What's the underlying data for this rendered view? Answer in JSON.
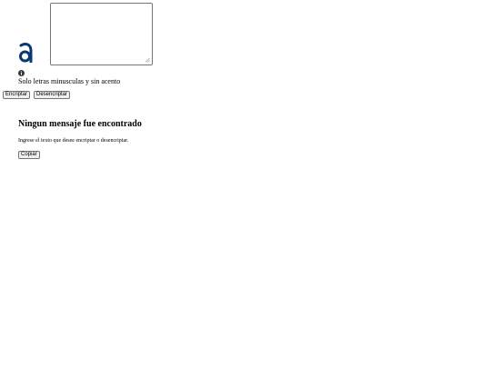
{
  "input": {
    "value": "",
    "placeholder": ""
  },
  "hint": {
    "icon": "info-icon",
    "text": "Solo letras minusculas y sin acento"
  },
  "actions": {
    "encrypt_label": "Encriptar",
    "decrypt_label": "Desencriptar"
  },
  "result": {
    "title": "Ningun mensaje fue encontrado",
    "text": "Ingrese el texto que desee encriptar o desencriptar.",
    "copy_label": "Copiar"
  },
  "colors": {
    "logo": "#0a3871",
    "info_icon": "#343a40",
    "button_bg": "#efefef",
    "button_border": "#767676"
  }
}
